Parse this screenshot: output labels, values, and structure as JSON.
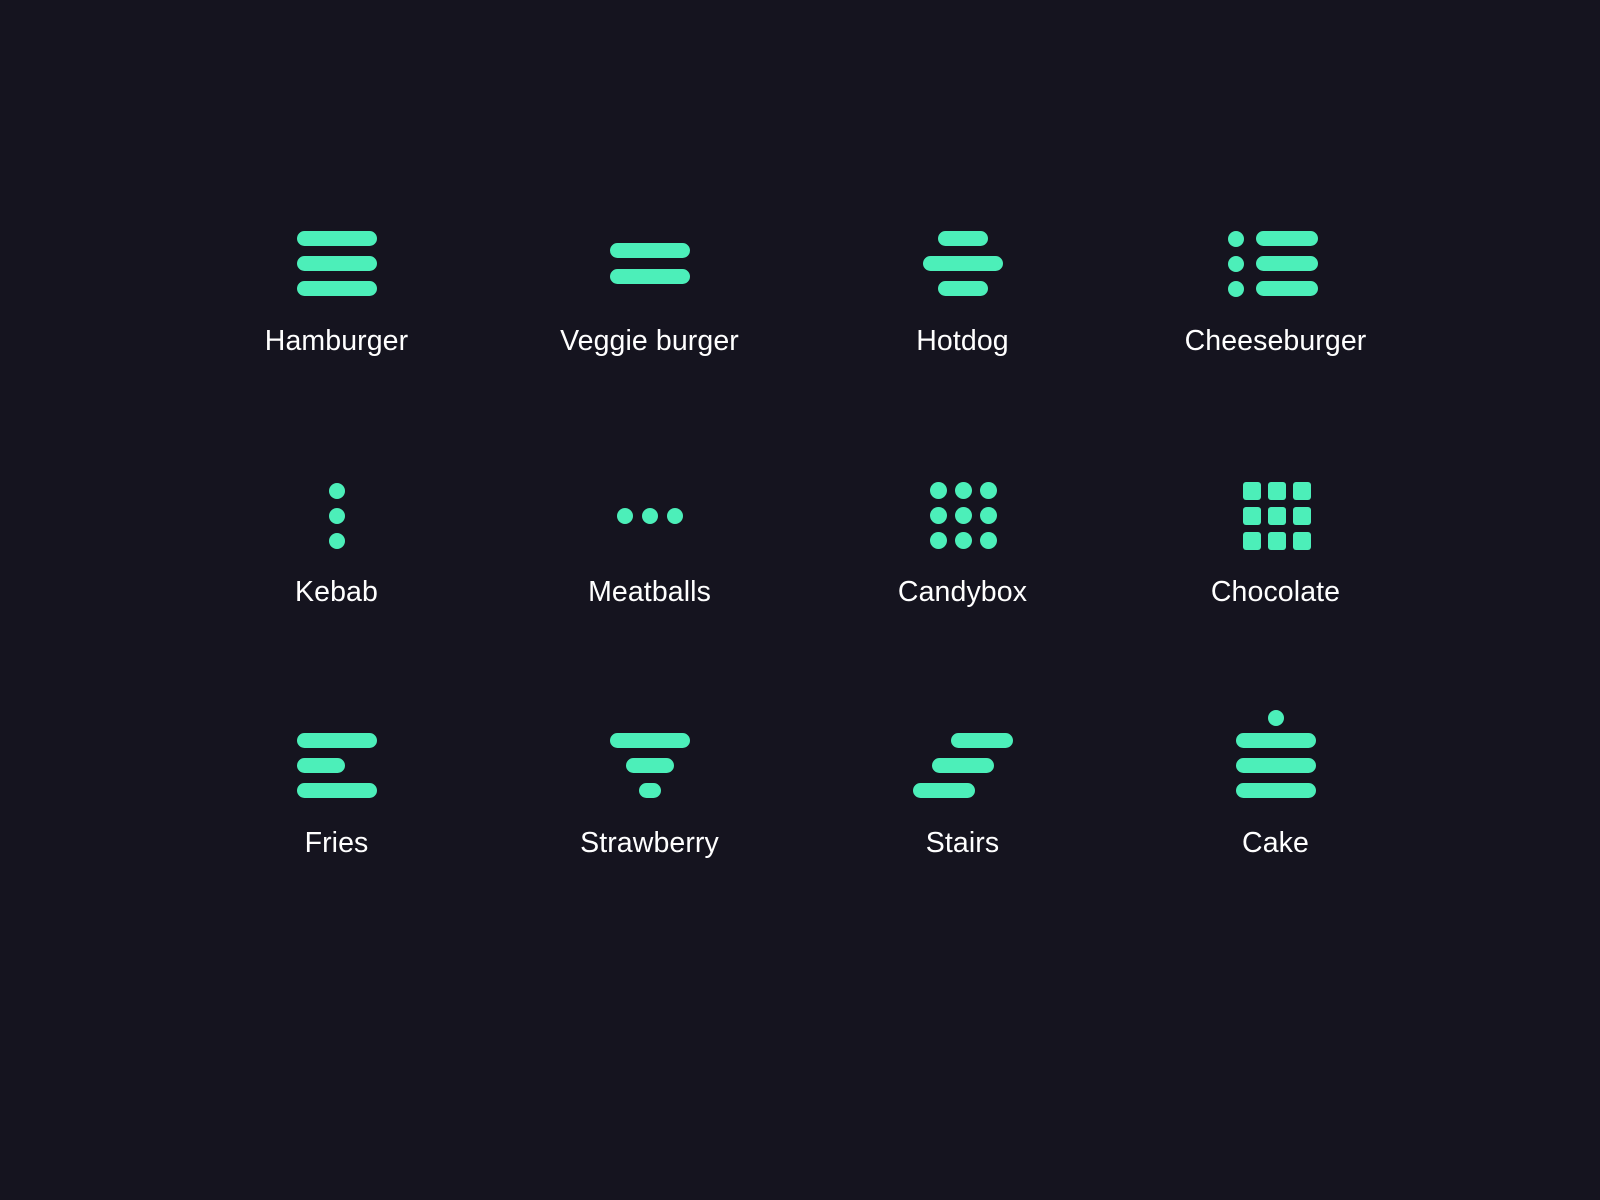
{
  "theme": {
    "background_color": "#15141F",
    "icon_color": "#4CEFB9",
    "label_color": "#FFFFFF"
  },
  "icons": [
    {
      "id": "hamburger",
      "label": "Hamburger",
      "glyph": "hamburger-menu-icon"
    },
    {
      "id": "veggie",
      "label": "Veggie burger",
      "glyph": "two-bar-menu-icon"
    },
    {
      "id": "hotdog",
      "label": "Hotdog",
      "glyph": "hotdog-menu-icon"
    },
    {
      "id": "cheese",
      "label": "Cheeseburger",
      "glyph": "bulleted-list-icon"
    },
    {
      "id": "kebab",
      "label": "Kebab",
      "glyph": "vertical-dots-icon"
    },
    {
      "id": "meatballs",
      "label": "Meatballs",
      "glyph": "horizontal-dots-icon"
    },
    {
      "id": "candybox",
      "label": "Candybox",
      "glyph": "dot-grid-icon"
    },
    {
      "id": "chocolate",
      "label": "Chocolate",
      "glyph": "square-grid-icon"
    },
    {
      "id": "fries",
      "label": "Fries",
      "glyph": "align-left-menu-icon"
    },
    {
      "id": "strawberry",
      "label": "Strawberry",
      "glyph": "funnel-menu-icon"
    },
    {
      "id": "stairs",
      "label": "Stairs",
      "glyph": "staggered-bars-icon"
    },
    {
      "id": "cake",
      "label": "Cake",
      "glyph": "cake-menu-icon"
    }
  ]
}
